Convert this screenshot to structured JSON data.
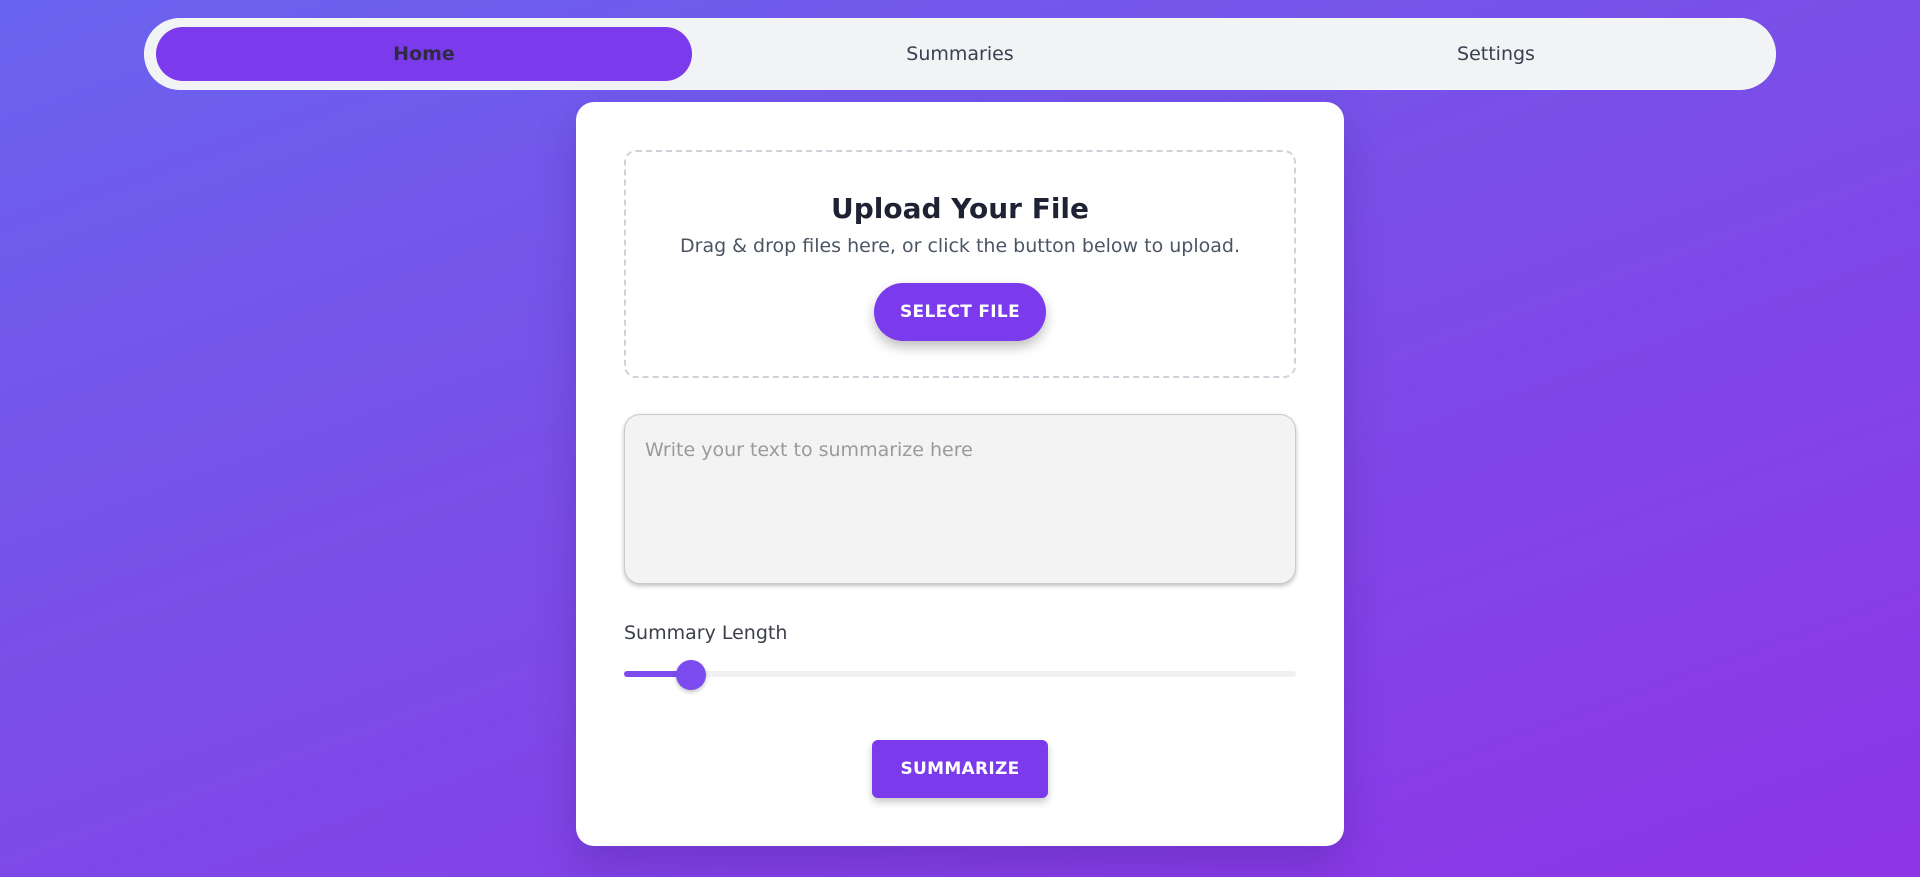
{
  "nav": {
    "tabs": [
      {
        "label": "Home",
        "active": true
      },
      {
        "label": "Summaries",
        "active": false
      },
      {
        "label": "Settings",
        "active": false
      }
    ]
  },
  "upload": {
    "title": "Upload Your File",
    "subtitle": "Drag & drop files here, or click the button below to upload.",
    "button_label": "SELECT FILE"
  },
  "text_input": {
    "placeholder": "Write your text to summarize here",
    "value": ""
  },
  "summary_length": {
    "label": "Summary Length",
    "value_fraction": 0.1
  },
  "actions": {
    "summarize_label": "SUMMARIZE"
  },
  "colors": {
    "accent": "#7b3aec",
    "slider": "#7b4bf0",
    "gradient_start": "#6a63f0",
    "gradient_end": "#8e35e6"
  }
}
